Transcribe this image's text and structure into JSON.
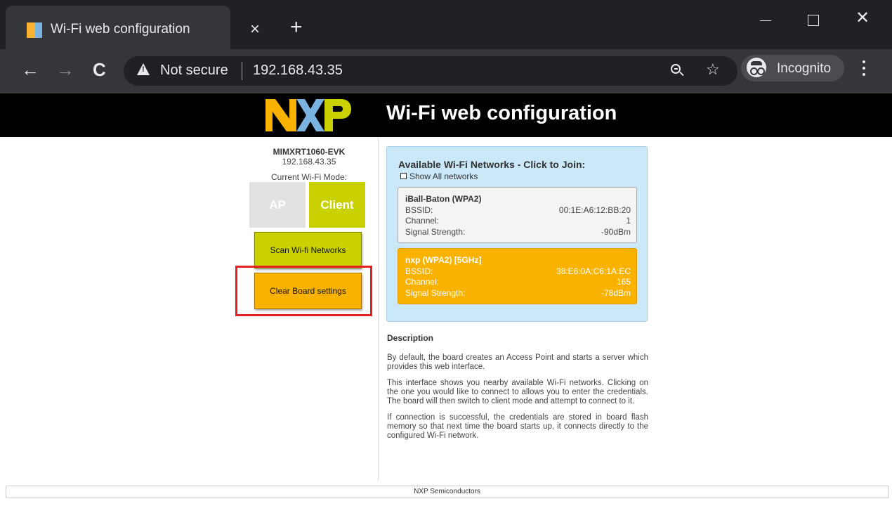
{
  "browser": {
    "tab_title": "Wi-Fi web configuration",
    "tab_close": "×",
    "new_tab": "+",
    "window_close": "✕",
    "back": "←",
    "forward": "→",
    "reload": "C",
    "security_label": "Not secure",
    "url": "192.168.43.35",
    "star": "☆",
    "incognito_label": "Incognito"
  },
  "header": {
    "logo_text": "NXP",
    "title": "Wi-Fi web configuration",
    "logo_colors": [
      "#f9b200",
      "#7ab2e0",
      "#c9d200"
    ]
  },
  "board": {
    "name": "MIMXRT1060-EVK",
    "ip": "192.168.43.35",
    "mode_label": "Current Wi-Fi Mode:",
    "modes": {
      "ap": "AP",
      "client": "Client",
      "selected": "Client"
    }
  },
  "buttons": {
    "scan": "Scan Wi-fi Networks",
    "clear": "Clear Board settings"
  },
  "networks": {
    "title": "Available Wi-Fi Networks - Click to Join:",
    "show_all_label": "Show All networks",
    "show_all_checked": false,
    "field_labels": {
      "bssid": "BSSID:",
      "channel": "Channel:",
      "signal": "Signal Strength:"
    },
    "items": [
      {
        "name": "iBall-Baton (WPA2)",
        "bssid": "00:1E:A6:12:BB:20",
        "channel": "1",
        "signal": "-90dBm"
      },
      {
        "name": "nxp (WPA2) [5GHz]",
        "bssid": "38:E6:0A:C6:1A:EC",
        "channel": "165",
        "signal": "-78dBm"
      }
    ]
  },
  "description": {
    "title": "Description",
    "paragraphs": [
      "By default, the board creates an Access Point and starts a server which provides this web interface.",
      "This interface shows you nearby available Wi-Fi networks. Clicking on the one you would like to connect to allows you to enter the credentials. The board will then switch to client mode and attempt to connect to it.",
      "If connection is successful, the credentials are stored in board flash memory so that next time the board starts up, it connects directly to the configured Wi-Fi network."
    ]
  },
  "footer": {
    "text": "NXP Semiconductors"
  },
  "colors": {
    "accent_green": "#c9d200",
    "accent_orange": "#f9b200",
    "panel_blue": "#cae8f8",
    "highlight_red": "#e52020"
  }
}
